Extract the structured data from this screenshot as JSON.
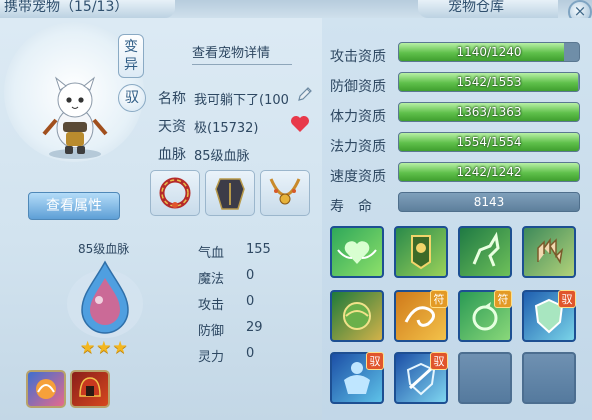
{
  "header": {
    "left_tab": "携带宠物（15/13）",
    "right_tab": "宠物仓库",
    "close_symbol": "×"
  },
  "pet": {
    "badge_variant": "变异",
    "badge_bound": "驭",
    "view_details": "查看宠物详情",
    "name_label": "名称",
    "name_value": "我可躺下了(100",
    "talent_label": "天资",
    "talent_value": "极(15732)",
    "blood_label": "血脉",
    "blood_value": "85级血脉",
    "view_attr_button": "查看属性",
    "blood_drop_label": "85级血脉",
    "stars": "★★★",
    "star_count": 3
  },
  "stats": [
    {
      "label": "气血",
      "value": "155"
    },
    {
      "label": "魔法",
      "value": "0"
    },
    {
      "label": "攻击",
      "value": "0"
    },
    {
      "label": "防御",
      "value": "29"
    },
    {
      "label": "灵力",
      "value": "0"
    }
  ],
  "aptitudes": [
    {
      "label": "攻击资质",
      "text": "1140/1240",
      "fraction": 0.919
    },
    {
      "label": "防御资质",
      "text": "1542/1553",
      "fraction": 0.993
    },
    {
      "label": "体力资质",
      "text": "1363/1363",
      "fraction": 1.0
    },
    {
      "label": "法力资质",
      "text": "1554/1554",
      "fraction": 1.0
    },
    {
      "label": "速度资质",
      "text": "1242/1242",
      "fraction": 1.0
    }
  ],
  "life": {
    "label": "寿　命",
    "value": "8143"
  },
  "equipment_icons": [
    "red-ring-icon",
    "dark-armor-icon",
    "gold-necklace-icon"
  ],
  "bottom_icons": [
    "fire-fist-icon",
    "red-helmet-icon"
  ],
  "skills": [
    {
      "icon": "winged-heart-icon",
      "tag": ""
    },
    {
      "icon": "war-banner-icon",
      "tag": ""
    },
    {
      "icon": "kicking-horse-icon",
      "tag": ""
    },
    {
      "icon": "grasping-hand-icon",
      "tag": ""
    },
    {
      "icon": "earth-orb-icon",
      "tag": ""
    },
    {
      "icon": "swirl-wind-icon",
      "tag": "符"
    },
    {
      "icon": "spinning-arrow-icon",
      "tag": "符"
    },
    {
      "icon": "shield-icon",
      "tag": "驭"
    },
    {
      "icon": "muscle-man-icon",
      "tag": "驭"
    },
    {
      "icon": "slash-shield-icon",
      "tag": "驭"
    }
  ],
  "colors": {
    "bar_fill": "#5fc04b",
    "button_blue": "#5e9fd6",
    "star_gold": "#f3b720",
    "tag_red": "#e0552b"
  }
}
